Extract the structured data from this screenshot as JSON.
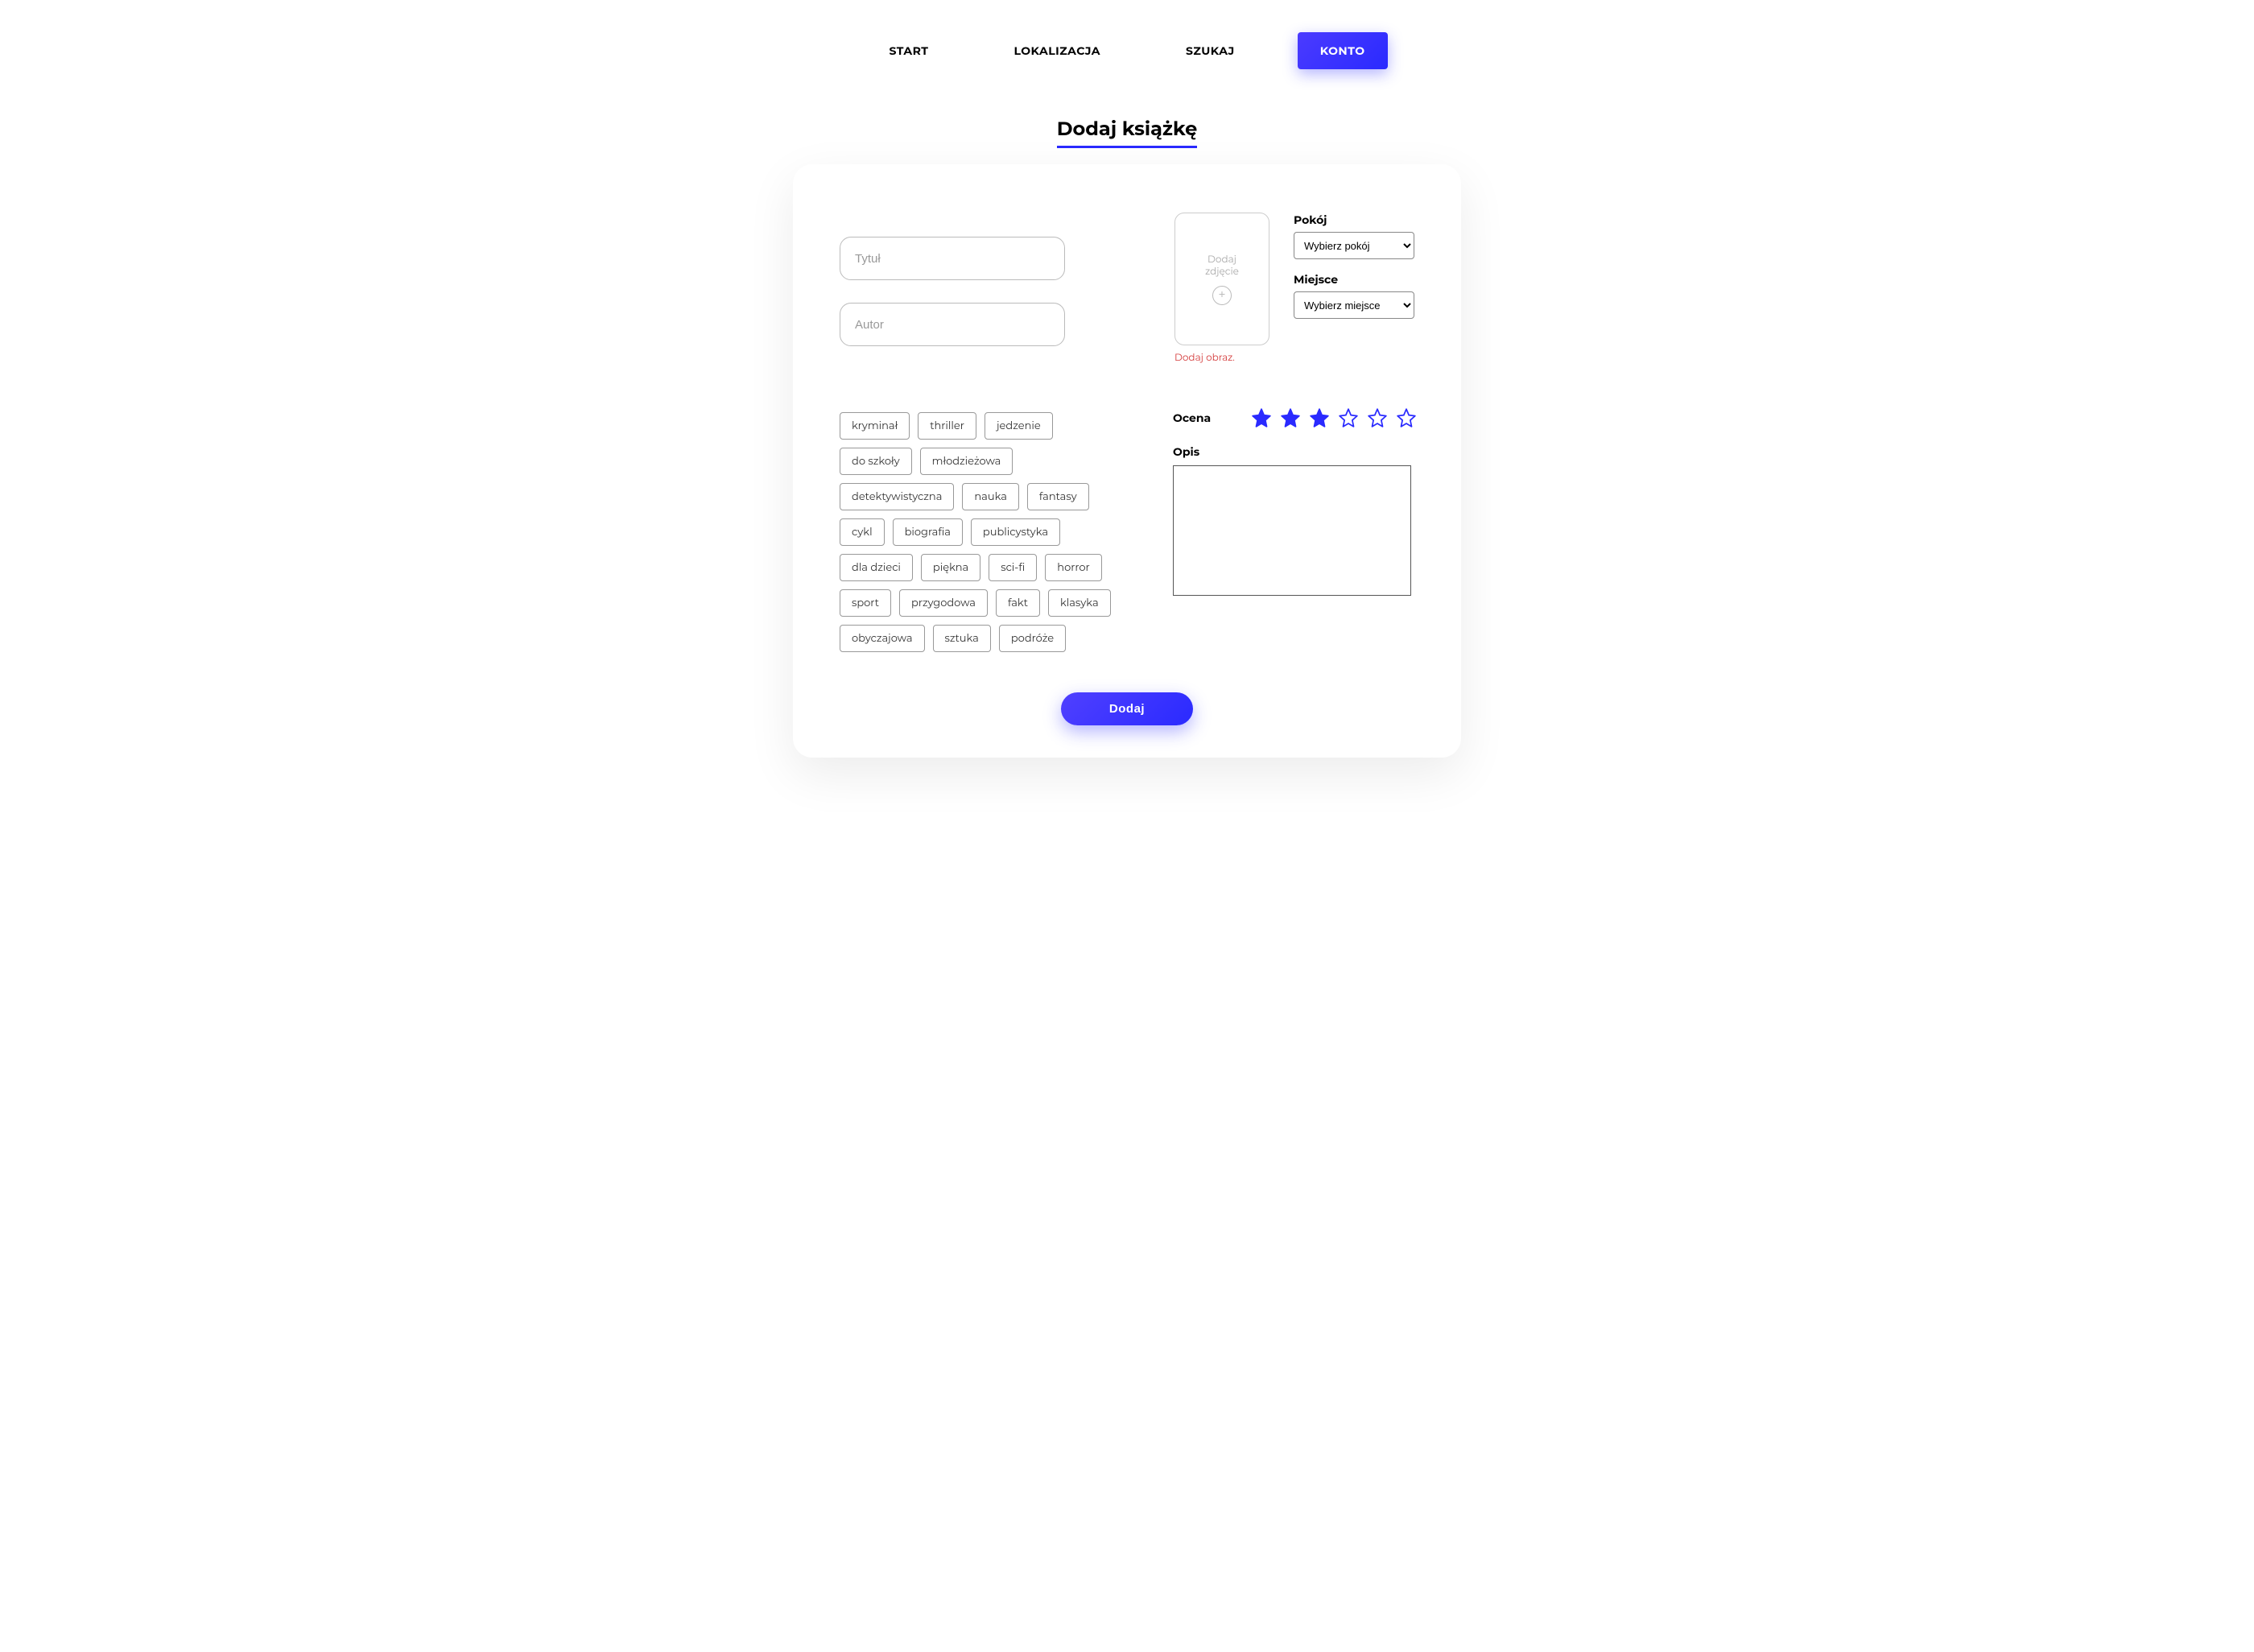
{
  "nav": {
    "items": [
      {
        "label": "START",
        "active": false
      },
      {
        "label": "LOKALIZACJA",
        "active": false
      },
      {
        "label": "SZUKAJ",
        "active": false
      },
      {
        "label": "KONTO",
        "active": true
      }
    ]
  },
  "page_title": "Dodaj książkę",
  "form": {
    "title_placeholder": "Tytuł",
    "author_placeholder": "Autor",
    "image_box_line1": "Dodaj",
    "image_box_line2": "zdjęcie",
    "image_error": "Dodaj obraz.",
    "room": {
      "label": "Pokój",
      "selected": "Wybierz pokój"
    },
    "place": {
      "label": "Miejsce",
      "selected": "Wybierz miejsce"
    },
    "rating_label": "Ocena",
    "rating_value": 3,
    "rating_max": 6,
    "description_label": "Opis",
    "description_value": "",
    "submit_label": "Dodaj"
  },
  "tags": [
    "kryminał",
    "thriller",
    "jedzenie",
    "do szkoły",
    "młodzieżowa",
    "detektywistyczna",
    "nauka",
    "fantasy",
    "cykl",
    "biografia",
    "publicystyka",
    "dla dzieci",
    "piękna",
    "sci-fi",
    "horror",
    "sport",
    "przygodowa",
    "fakt",
    "klasyka",
    "obyczajowa",
    "sztuka",
    "podróże"
  ],
  "colors": {
    "accent": "#2a2aff",
    "error": "#d43b3b"
  }
}
